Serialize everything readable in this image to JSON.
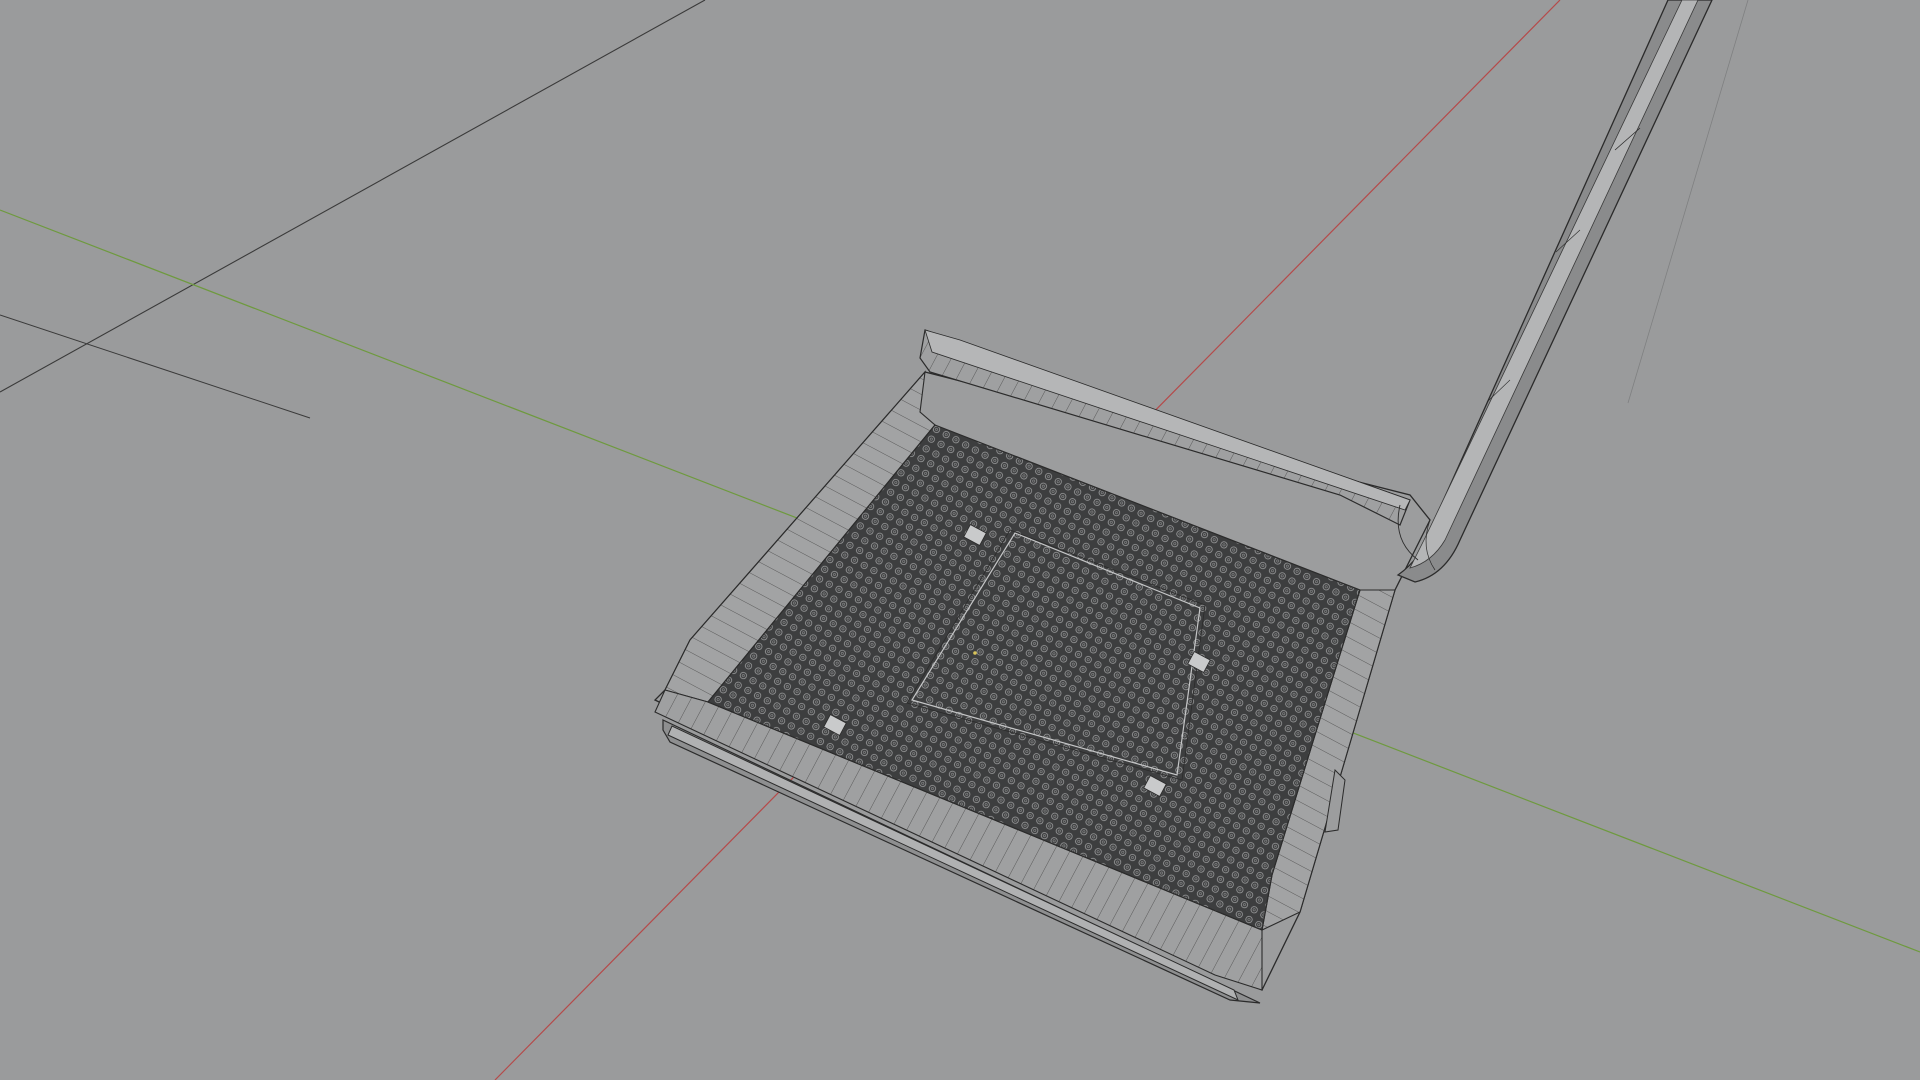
{
  "viewport": {
    "background": "#9a9b9c",
    "display_mode": "wireframe",
    "axes": {
      "x_axis_color": "#b54a4a",
      "y_axis_color": "#6e9a3e",
      "grid_line_color": "#3a3a3a"
    },
    "model": {
      "name": "cpu-socket",
      "wire_color": "#2b2b2b",
      "surface_color": "#8f9091",
      "pin_field_color": "#3d3e3f"
    }
  }
}
